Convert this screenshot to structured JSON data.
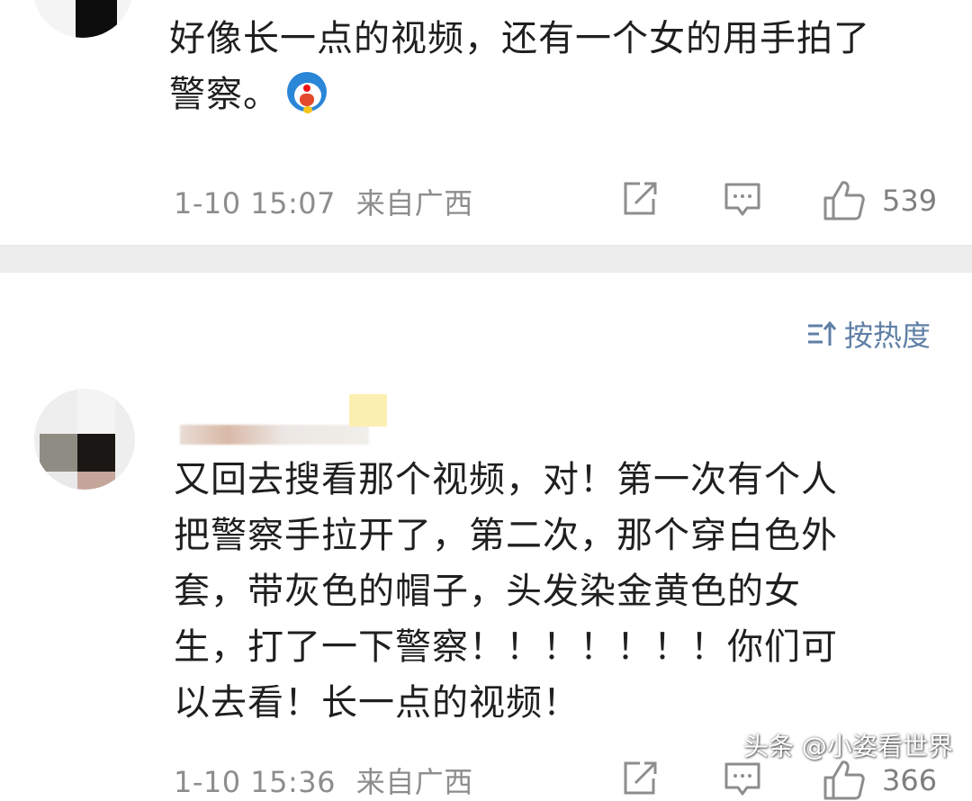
{
  "comments": [
    {
      "text_line1": "好像长一点的视频，还有一个女的用手拍了",
      "text_line2": "警察。",
      "emoji": "doraemon-emoji",
      "time": "1-10 15:07",
      "location": "来自广西",
      "likes": "539"
    },
    {
      "text_line1": "又回去搜看那个视频，对！第一次有个人",
      "text_line2": "把警察手拉开了，第二次，那个穿白色外",
      "text_line3": "套，带灰色的帽子，头发染金黄色的女",
      "text_line4": "生，打了一下警察！！！！！！！你们可",
      "text_line5": "以去看！长一点的视频！",
      "time": "1-10 15:36",
      "location": "来自广西",
      "likes": "366"
    }
  ],
  "sort": {
    "label": "按热度",
    "icon": "sort-icon"
  },
  "watermark": "头条 @小姿看世界",
  "colors": {
    "meta_gray": "#8d8d8d",
    "sort_blue": "#5f7fa6",
    "divider": "#ededed"
  }
}
